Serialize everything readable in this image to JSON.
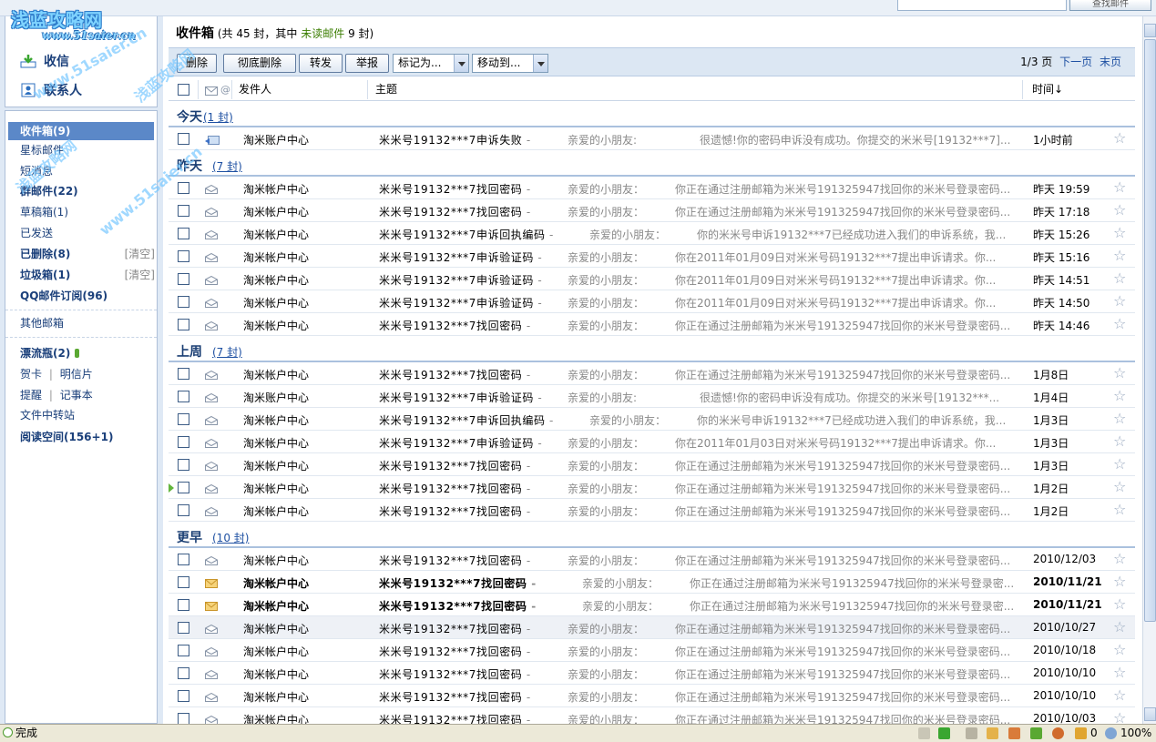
{
  "topbar": {
    "search_button_label": "查找邮件"
  },
  "brand": {
    "logo_text": "浅蓝攻略网",
    "logo_url": "www.51saier.cn"
  },
  "nav": {
    "receive_label": "收信",
    "contacts_label": "联系人"
  },
  "folders": [
    {
      "label": "收件箱(9)",
      "clear": ""
    },
    {
      "label": "星标邮件",
      "clear": ""
    },
    {
      "label": "短消息",
      "clear": ""
    },
    {
      "label": "群邮件(22)",
      "clear": ""
    },
    {
      "label": "草稿箱(1)",
      "clear": ""
    },
    {
      "label": "已发送",
      "clear": ""
    },
    {
      "label": "已删除(8)",
      "clear": "[清空]"
    },
    {
      "label": "垃圾箱(1)",
      "clear": "[清空]"
    },
    {
      "label": "QQ邮件订阅(96)",
      "clear": ""
    }
  ],
  "other_mailbox": "其他邮箱",
  "drift_bottle": "漂流瓶(2)",
  "extras": {
    "card": "贺卡",
    "sep": "|",
    "postcard": "明信片",
    "reminder": "提醒",
    "notepad": "记事本",
    "file_transfer": "文件中转站",
    "reading": "阅读空间(156+1)"
  },
  "header": {
    "title": "收件箱",
    "summary_pre": "(共 45 封，其中",
    "unread_label": "未读邮件",
    "summary_post": "9 封)"
  },
  "toolbar": {
    "delete_label": "删除",
    "perm_delete_label": "彻底删除",
    "forward_label": "转发",
    "report_label": "举报",
    "mark_as_label": "标记为...",
    "move_to_label": "移动到...",
    "page_info": "1/3 页",
    "next_page_label": "下一页",
    "last_page_label": "末页"
  },
  "columns": {
    "sender": "发件人",
    "subject": "主题",
    "time": "时间↓"
  },
  "groups": {
    "today": {
      "label": "今天",
      "count": "(1 封)"
    },
    "yesterday": {
      "label": "昨天",
      "count": "(7 封)"
    },
    "last_week": {
      "label": "上周",
      "count": "(7 封)"
    },
    "earlier": {
      "label": "更早",
      "count": "(10 封)"
    }
  },
  "emails_today": [
    {
      "sender": "淘米账户中心",
      "subject": "米米号19132***7申诉失败",
      "greeting": "亲爱的小朋友:",
      "preview": "很遗憾!你的密码申诉没有成功。你提交的米米号[19132***7]...",
      "time": "1小时前"
    }
  ],
  "emails_yesterday": [
    {
      "sender": "淘米帐户中心",
      "subject": "米米号19132***7找回密码",
      "greeting": "亲爱的小朋友：",
      "preview": "你正在通过注册邮箱为米米号191325947找回你的米米号登录密码...",
      "time": "昨天 19:59"
    },
    {
      "sender": "淘米帐户中心",
      "subject": "米米号19132***7找回密码",
      "greeting": "亲爱的小朋友：",
      "preview": "你正在通过注册邮箱为米米号191325947找回你的米米号登录密码...",
      "time": "昨天 17:18"
    },
    {
      "sender": "淘米帐户中心",
      "subject": "米米号19132***7申诉回执编码",
      "greeting": "亲爱的小朋友：",
      "preview": "你的米米号申诉19132***7已经成功进入我们的申诉系统，我...",
      "time": "昨天 15:26"
    },
    {
      "sender": "淘米帐户中心",
      "subject": "米米号19132***7申诉验证码",
      "greeting": "亲爱的小朋友：",
      "preview": "你在2011年01月09日对米米号码19132***7提出申诉请求。你...",
      "time": "昨天 15:16"
    },
    {
      "sender": "淘米帐户中心",
      "subject": "米米号19132***7申诉验证码",
      "greeting": "亲爱的小朋友：",
      "preview": "你在2011年01月09日对米米号码19132***7提出申诉请求。你...",
      "time": "昨天 14:51"
    },
    {
      "sender": "淘米帐户中心",
      "subject": "米米号19132***7申诉验证码",
      "greeting": "亲爱的小朋友：",
      "preview": "你在2011年01月09日对米米号码19132***7提出申诉请求。你...",
      "time": "昨天 14:50"
    },
    {
      "sender": "淘米帐户中心",
      "subject": "米米号19132***7找回密码",
      "greeting": "亲爱的小朋友：",
      "preview": "你正在通过注册邮箱为米米号191325947找回你的米米号登录密码...",
      "time": "昨天 14:46"
    }
  ],
  "emails_last_week": [
    {
      "sender": "淘米帐户中心",
      "subject": "米米号19132***7找回密码",
      "greeting": "亲爱的小朋友：",
      "preview": "你正在通过注册邮箱为米米号191325947找回你的米米号登录密码...",
      "time": "1月8日"
    },
    {
      "sender": "淘米账户中心",
      "subject": "米米号19132***7申诉验证码",
      "greeting": "亲爱的小朋友:",
      "preview": "很遗憾!你的密码申诉没有成功。你提交的米米号[19132***...",
      "time": "1月4日"
    },
    {
      "sender": "淘米帐户中心",
      "subject": "米米号19132***7申诉回执编码",
      "greeting": "亲爱的小朋友：",
      "preview": "你的米米号申诉19132***7已经成功进入我们的申诉系统，我...",
      "time": "1月3日"
    },
    {
      "sender": "淘米帐户中心",
      "subject": "米米号19132***7申诉验证码",
      "greeting": "亲爱的小朋友：",
      "preview": "你在2011年01月03日对米米号码19132***7提出申诉请求。你...",
      "time": "1月3日"
    },
    {
      "sender": "淘米帐户中心",
      "subject": "米米号19132***7找回密码",
      "greeting": "亲爱的小朋友：",
      "preview": "你正在通过注册邮箱为米米号191325947找回你的米米号登录密码...",
      "time": "1月3日"
    },
    {
      "sender": "淘米帐户中心",
      "subject": "米米号19132***7找回密码",
      "greeting": "亲爱的小朋友：",
      "preview": "你正在通过注册邮箱为米米号191325947找回你的米米号登录密码...",
      "time": "1月2日"
    },
    {
      "sender": "淘米帐户中心",
      "subject": "米米号19132***7找回密码",
      "greeting": "亲爱的小朋友：",
      "preview": "你正在通过注册邮箱为米米号191325947找回你的米米号登录密码...",
      "time": "1月2日"
    }
  ],
  "emails_earlier": [
    {
      "sender": "淘米帐户中心",
      "subject": "米米号19132***7找回密码",
      "greeting": "亲爱的小朋友：",
      "preview": "你正在通过注册邮箱为米米号191325947找回你的米米号登录密码...",
      "time": "2010/12/03"
    },
    {
      "sender": "淘米帐户中心",
      "subject": "米米号19132***7找回密码",
      "greeting": "亲爱的小朋友：",
      "preview": "你正在通过注册邮箱为米米号191325947找回你的米米号登录密...",
      "time": "2010/11/21"
    },
    {
      "sender": "淘米帐户中心",
      "subject": "米米号19132***7找回密码",
      "greeting": "亲爱的小朋友：",
      "preview": "你正在通过注册邮箱为米米号191325947找回你的米米号登录密...",
      "time": "2010/11/21"
    },
    {
      "sender": "淘米帐户中心",
      "subject": "米米号19132***7找回密码",
      "greeting": "亲爱的小朋友：",
      "preview": "你正在通过注册邮箱为米米号191325947找回你的米米号登录密码...",
      "time": "2010/10/27"
    },
    {
      "sender": "淘米帐户中心",
      "subject": "米米号19132***7找回密码",
      "greeting": "亲爱的小朋友：",
      "preview": "你正在通过注册邮箱为米米号191325947找回你的米米号登录密码...",
      "time": "2010/10/18"
    },
    {
      "sender": "淘米帐户中心",
      "subject": "米米号19132***7找回密码",
      "greeting": "亲爱的小朋友：",
      "preview": "你正在通过注册邮箱为米米号191325947找回你的米米号登录密码...",
      "time": "2010/10/10"
    },
    {
      "sender": "淘米帐户中心",
      "subject": "米米号19132***7找回密码",
      "greeting": "亲爱的小朋友：",
      "preview": "你正在通过注册邮箱为米米号191325947找回你的米米号登录密码...",
      "time": "2010/10/10"
    },
    {
      "sender": "淘米帐户中心",
      "subject": "米米号19132***7找回密码",
      "greeting": "亲爱的小朋友：",
      "preview": "你正在通过注册邮箱为米米号191325947找回你的米米号登录密码...",
      "time": "2010/10/03"
    }
  ],
  "statusbar": {
    "text": "完成",
    "blocked_count": "0",
    "zoom": "100%"
  },
  "colors": {
    "sidebar_bg": "#dfe9f5",
    "selected_folder": "#5b88c8",
    "link": "#1e50a2",
    "unread_text": "#3a7d00",
    "group_border": "#aac1de"
  }
}
